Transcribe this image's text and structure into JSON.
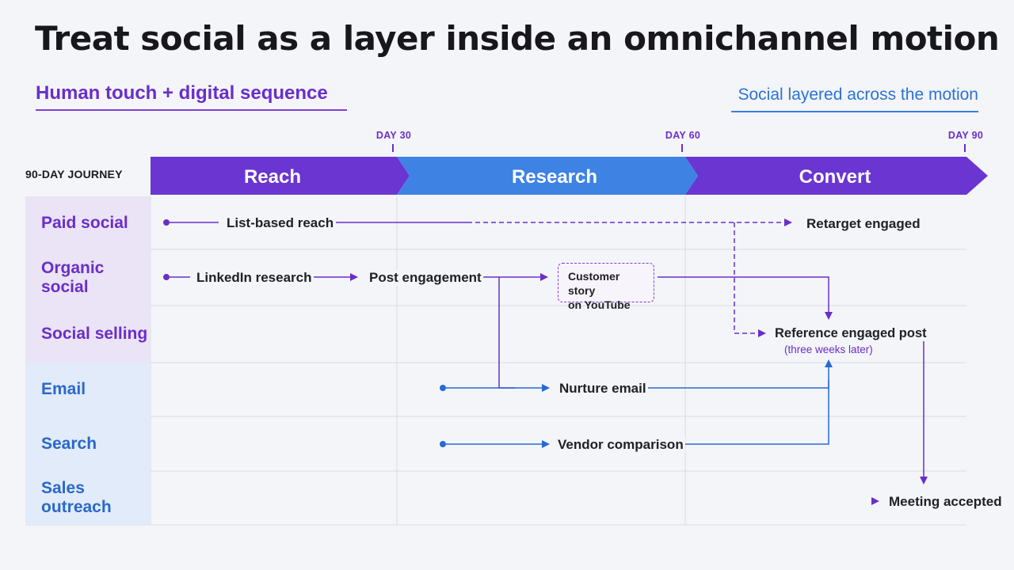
{
  "title": "Treat social as a layer inside an omnichannel motion",
  "subtitle_left": "Human touch + digital sequence",
  "subtitle_right": "Social layered across the motion",
  "timeline": {
    "journey_label": "90-DAY JOURNEY",
    "days": [
      "DAY 30",
      "DAY 60",
      "DAY 90"
    ],
    "phases": [
      "Reach",
      "Research",
      "Convert"
    ]
  },
  "rows": [
    "Paid social",
    "Organic social",
    "Social selling",
    "Email",
    "Search",
    "Sales outreach"
  ],
  "nodes": {
    "list_reach": "List-based reach",
    "retarget": "Retarget engaged",
    "linkedin": "LinkedIn research",
    "post_engagement": "Post engagement",
    "story_line1": "Customer story",
    "story_line2": "on YouTube",
    "reference_post": "Reference engaged post",
    "reference_note": "(three weeks later)",
    "nurture_email": "Nurture email",
    "vendor_comparison": "Vendor comparison",
    "meeting": "Meeting accepted"
  },
  "colors": {
    "purple": "#6a2ec9",
    "blue": "#2a73d6",
    "reach_band": "#6a35d1",
    "research_band": "#3e83e4",
    "convert_band": "#6a35d1"
  }
}
